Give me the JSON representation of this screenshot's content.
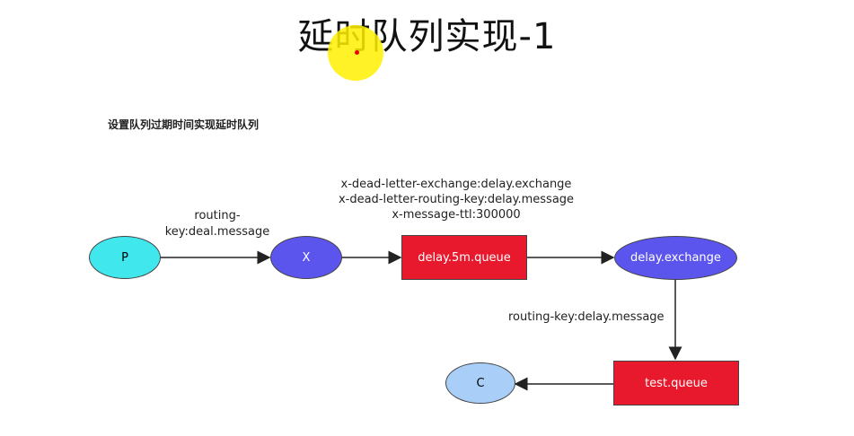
{
  "title": "延时队列实现-1",
  "subtitle": "设置队列过期时间实现延时队列",
  "nodes": {
    "p": "P",
    "x": "X",
    "delay_queue": "delay.5m.queue",
    "delay_exchange": "delay.exchange",
    "test_queue": "test.queue",
    "c": "C"
  },
  "labels": {
    "routing_key_1_line1": "routing-",
    "routing_key_1_line2": "key:deal.message",
    "queue_args": [
      "x-dead-letter-exchange:delay.exchange",
      "x-dead-letter-routing-key:delay.message",
      "x-message-ttl:300000"
    ],
    "routing_key_2": "routing-key:delay.message"
  },
  "colors": {
    "p_fill": "#40e8ee",
    "x_fill": "#5b55ee",
    "queue_fill": "#e8192c",
    "exchange_fill": "#5b55ee",
    "c_fill": "#a9cff8",
    "highlight": "#fff000"
  }
}
